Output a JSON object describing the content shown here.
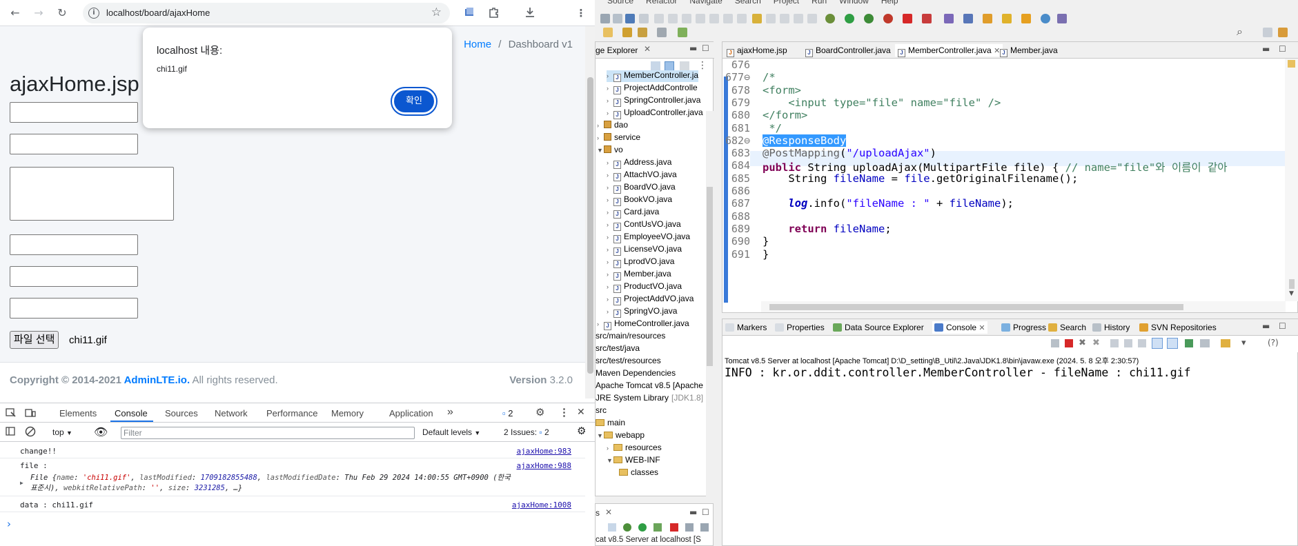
{
  "browser": {
    "url": "localhost/board/ajaxHome",
    "breadcrumb": {
      "home": "Home",
      "separator": "/",
      "current": "Dashboard v1"
    },
    "page_title": "ajaxHome.jsp",
    "file_button": "파일 선택",
    "file_name": "chi11.gif",
    "footer": {
      "copyright_prefix": "Copyright © 2014-2021 ",
      "brand": "AdminLTE.io.",
      "rights": " All rights reserved.",
      "version_label": "Version",
      "version_value": "3.2.0"
    },
    "alert": {
      "title": "localhost 내용:",
      "message": "chi11.gif",
      "ok_label": "확인"
    }
  },
  "devtools": {
    "tabs": [
      "Elements",
      "Console",
      "Sources",
      "Network",
      "Performance",
      "Memory",
      "Application"
    ],
    "active_tab": "Console",
    "more_tabs": "»",
    "issue_badge": "2",
    "context": "top",
    "filter_placeholder": "Filter",
    "levels": "Default levels",
    "issues_label": "2 Issues:",
    "issues_count": "2",
    "logs": [
      {
        "text": "change!!",
        "source": "ajaxHome:983"
      },
      {
        "text": "file :",
        "source": "ajaxHome:988"
      },
      {
        "text": "data : chi11.gif",
        "source": "ajaxHome:1008"
      }
    ],
    "file_obj": {
      "line1_prefix": "File {",
      "name_key": "name",
      "name_val": "'chi11.gif'",
      "lm_key": "lastModified",
      "lm_val": "1709182855488",
      "lmd_key": "lastModifiedDate",
      "lmd_val": "Thu Feb 29 2024 14:00:55 GMT+0900 (한국",
      "line2_pre": "표준시)",
      "wrp_key": "webkitRelativePath",
      "wrp_val": "''",
      "size_key": "size",
      "size_val": "3231285",
      "line2_tail": ", …}"
    },
    "prompt": "›"
  },
  "eclipse": {
    "menu": [
      "Source",
      "Refactor",
      "Navigate",
      "Search",
      "Project",
      "Run",
      "Window",
      "Help"
    ],
    "package_explorer_label": "ge Explorer",
    "tree": [
      {
        "label": "MemberController.ja",
        "kind": "java",
        "indent": 1
      },
      {
        "label": "ProjectAddControlle",
        "kind": "java",
        "indent": 1
      },
      {
        "label": "SpringController.java",
        "kind": "java",
        "indent": 1
      },
      {
        "label": "UploadController.java",
        "kind": "java",
        "indent": 1
      },
      {
        "label": "dao",
        "kind": "pkg",
        "indent": 0
      },
      {
        "label": "service",
        "kind": "pkg",
        "indent": 0
      },
      {
        "label": "vo",
        "kind": "pkg-open",
        "indent": 0
      },
      {
        "label": "Address.java",
        "kind": "java",
        "indent": 1
      },
      {
        "label": "AttachVO.java",
        "kind": "java",
        "indent": 1
      },
      {
        "label": "BoardVO.java",
        "kind": "java",
        "indent": 1
      },
      {
        "label": "BookVO.java",
        "kind": "java",
        "indent": 1
      },
      {
        "label": "Card.java",
        "kind": "java",
        "indent": 1
      },
      {
        "label": "ContUsVO.java",
        "kind": "java",
        "indent": 1
      },
      {
        "label": "EmployeeVO.java",
        "kind": "java",
        "indent": 1
      },
      {
        "label": "LicenseVO.java",
        "kind": "java",
        "indent": 1
      },
      {
        "label": "LprodVO.java",
        "kind": "java",
        "indent": 1
      },
      {
        "label": "Member.java",
        "kind": "java",
        "indent": 1
      },
      {
        "label": "ProductVO.java",
        "kind": "java",
        "indent": 1
      },
      {
        "label": "ProjectAddVO.java",
        "kind": "java",
        "indent": 1
      },
      {
        "label": "SpringVO.java",
        "kind": "java",
        "indent": 1
      },
      {
        "label": "HomeController.java",
        "kind": "java",
        "indent": 0
      },
      {
        "label": "src/main/resources",
        "kind": "plain",
        "indent": -1
      },
      {
        "label": "src/test/java",
        "kind": "plain",
        "indent": -1
      },
      {
        "label": "src/test/resources",
        "kind": "plain",
        "indent": -1
      },
      {
        "label": "Maven Dependencies",
        "kind": "plain",
        "indent": -1
      },
      {
        "label": "Apache Tomcat v8.5 [Apache",
        "kind": "plain",
        "indent": -1
      },
      {
        "label": "JRE System Library",
        "kind": "jre",
        "indent": -1,
        "suffix": "[JDK1.8]"
      },
      {
        "label": "src",
        "kind": "plain",
        "indent": -1
      },
      {
        "label": "main",
        "kind": "folder-open",
        "indent": -1
      },
      {
        "label": "webapp",
        "kind": "folder-open",
        "indent": 0
      },
      {
        "label": "resources",
        "kind": "folder",
        "indent": 1
      },
      {
        "label": "WEB-INF",
        "kind": "folder-open",
        "indent": 1
      },
      {
        "label": "classes",
        "kind": "folder-leaf",
        "indent": 2
      }
    ],
    "editor_tabs": [
      "ajaxHome.jsp",
      "BoardController.java",
      "MemberController.java",
      "Member.java"
    ],
    "active_editor_tab": "MemberController.java",
    "code": [
      {
        "n": "676",
        "t": ""
      },
      {
        "n": "677⊖",
        "t": "/*"
      },
      {
        "n": "678",
        "t": "<form>"
      },
      {
        "n": "679",
        "t": "    <input type=\"file\" name=\"file\" />"
      },
      {
        "n": "680",
        "t": "</form>"
      },
      {
        "n": "681",
        "t": " */"
      },
      {
        "n": "682⊖",
        "t": "@ResponseBody"
      },
      {
        "n": "683",
        "t": "@PostMapping(\"/uploadAjax\")"
      },
      {
        "n": "684",
        "t": "public String uploadAjax(MultipartFile file) { // name=\"file\"와 이름이 같아"
      },
      {
        "n": "685",
        "t": "    String fileName = file.getOriginalFilename();"
      },
      {
        "n": "686",
        "t": ""
      },
      {
        "n": "687",
        "t": "    log.info(\"fileName : \" + fileName);"
      },
      {
        "n": "688",
        "t": ""
      },
      {
        "n": "689",
        "t": "    return fileName;"
      },
      {
        "n": "690",
        "t": "}"
      },
      {
        "n": "691",
        "t": "}"
      }
    ],
    "console_tabs": [
      "Markers",
      "Properties",
      "Data Source Explorer",
      "Console",
      "Progress",
      "Search",
      "History",
      "SVN Repositories"
    ],
    "active_console_tab": "Console",
    "console_title": "Tomcat v8.5 Server at localhost [Apache Tomcat] D:\\D_setting\\B_Util\\2.Java\\JDK1.8\\bin\\javaw.exe  (2024. 5. 8 오후 2:30:57)",
    "console_log": "INFO : kr.or.ddit.controller.MemberController - fileName : chi11.gif",
    "servers_label": "cat v8.5 Server at localhost [S"
  }
}
